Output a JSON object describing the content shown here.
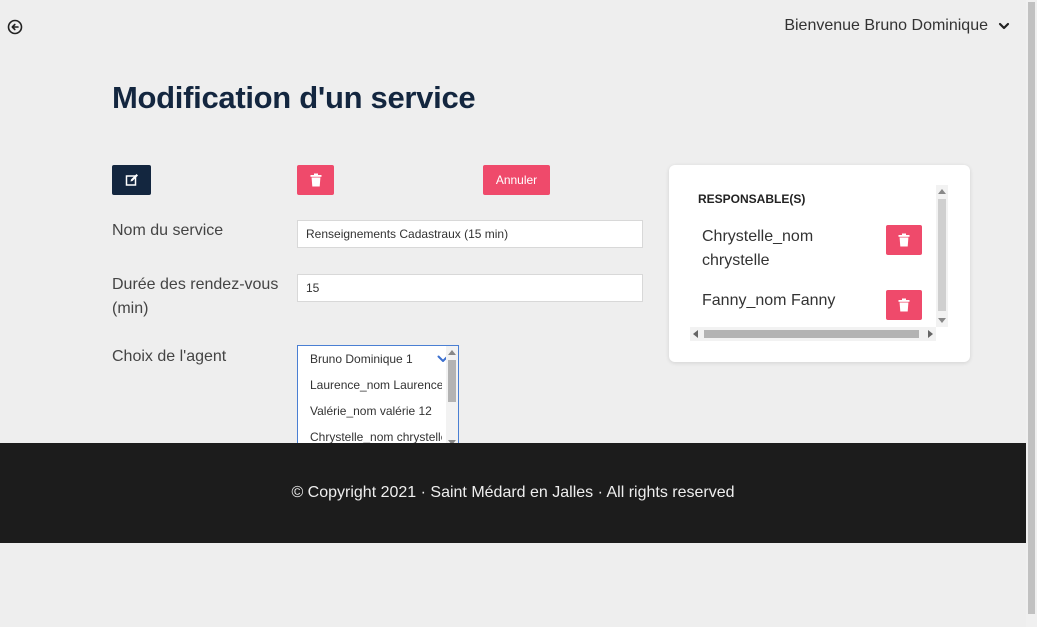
{
  "header": {
    "back_icon": "circle-arrow-left-icon",
    "user_greeting": "Bienvenue Bruno Dominique",
    "dropdown_icon": "chevron-down-icon"
  },
  "page": {
    "title": "Modification d'un service"
  },
  "toolbar": {
    "edit_icon": "edit-icon",
    "delete_icon": "trash-icon",
    "cancel_label": "Annuler",
    "accent_dark": "#13263f",
    "accent_danger": "#ef4a6b"
  },
  "form": {
    "service_name_label": "Nom du service",
    "service_name_value": "Renseignements Cadastraux (15 min)",
    "duration_label_line1": "Durée des rendez-vous",
    "duration_label_line2": "(min)",
    "duration_value": "15",
    "agent_label": "Choix de l'agent",
    "agent_options": [
      "Bruno Dominique 1",
      "Laurence_nom Laurence",
      "Valérie_nom valérie 12",
      "Chrystelle_nom chrystelle"
    ]
  },
  "responsables": {
    "heading": "RESPONSABLE(S)",
    "items": [
      {
        "line1": "Chrystelle_nom",
        "line2": "chrystelle"
      },
      {
        "line1": "Fanny_nom Fanny",
        "line2": ""
      }
    ]
  },
  "footer": {
    "text": "© Copyright 2021 · Saint Médard en Jalles · All rights reserved"
  }
}
